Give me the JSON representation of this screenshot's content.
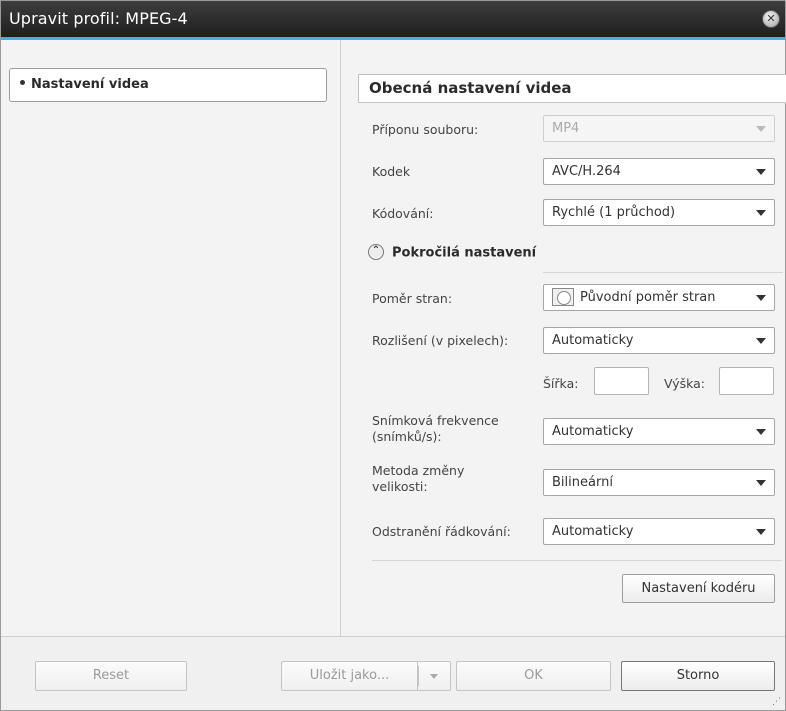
{
  "window": {
    "title": "Upravit profil: MPEG-4",
    "close_icon": "close-circle-icon"
  },
  "sidebar": {
    "items": [
      {
        "label": "Nastavení videa",
        "selected": true
      }
    ]
  },
  "main": {
    "section_title": "Obecná nastavení videa",
    "extension": {
      "label": "Příponu souboru:",
      "value": "MP4",
      "disabled": true
    },
    "codec": {
      "label": "Kodek",
      "value": "AVC/H.264"
    },
    "encoding": {
      "label": "Kódování:",
      "value": "Rychlé (1 průchod)"
    },
    "advanced": {
      "label": "Pokročilá nastavení",
      "expanded": true,
      "icon": "chevron-up-icon"
    },
    "aspect_ratio": {
      "label": "Poměr stran:",
      "value": "Původní poměr stran",
      "icon": "aspect-ratio-icon"
    },
    "resolution": {
      "label": "Rozlišení (v pixelech):",
      "value": "Automaticky"
    },
    "width": {
      "label": "Šířka:",
      "value": ""
    },
    "height": {
      "label": "Výška:",
      "value": ""
    },
    "frame_rate": {
      "label_line1": "Snímková frekvence",
      "label_line2": "(snímků/s):",
      "value": "Automaticky"
    },
    "resize_method": {
      "label_line1": "Metoda změny",
      "label_line2": "velikosti:",
      "value": "Bilineární"
    },
    "deinterlace": {
      "label": "Odstranění řádkování:",
      "value": "Automaticky"
    },
    "encoder_settings_button": "Nastavení kodéru"
  },
  "footer": {
    "reset": "Reset",
    "save_as": "Uložit jako...",
    "ok": "OK",
    "cancel": "Storno"
  },
  "colors": {
    "titlebar": "#1f1f1f",
    "accent": "#3db4e8",
    "background": "#f3f3f3"
  }
}
